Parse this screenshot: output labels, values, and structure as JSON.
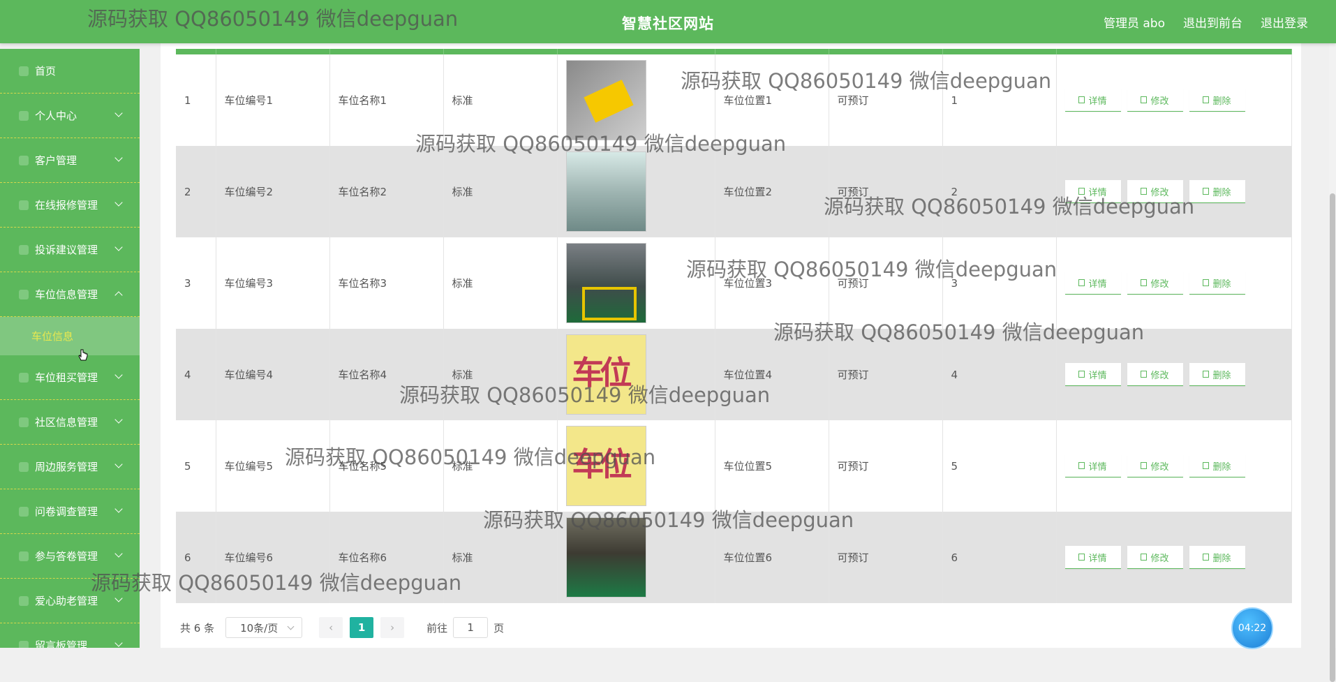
{
  "header": {
    "title": "智慧社区网站",
    "admin_label": "管理员 abo",
    "to_front": "退出到前台",
    "logout": "退出登录"
  },
  "sidebar": {
    "items": [
      {
        "label": "首页",
        "icon": "home-icon",
        "expandable": false
      },
      {
        "label": "个人中心",
        "icon": "user-icon",
        "expandable": true
      },
      {
        "label": "客户管理",
        "icon": "user-icon",
        "expandable": true
      },
      {
        "label": "在线报修管理",
        "icon": "repair-icon",
        "expandable": true
      },
      {
        "label": "投诉建议管理",
        "icon": "complaint-icon",
        "expandable": true
      },
      {
        "label": "车位信息管理",
        "icon": "parking-icon",
        "expandable": true,
        "expanded": true
      }
    ],
    "active_sub": "车位信息",
    "items_after": [
      {
        "label": "车位租买管理",
        "icon": "parking-icon"
      },
      {
        "label": "社区信息管理",
        "icon": "community-icon"
      },
      {
        "label": "周边服务管理",
        "icon": "service-icon"
      },
      {
        "label": "问卷调查管理",
        "icon": "survey-icon"
      },
      {
        "label": "参与答卷管理",
        "icon": "survey-icon"
      },
      {
        "label": "爱心助老管理",
        "icon": "heart-icon"
      },
      {
        "label": "留言板管理",
        "icon": "message-icon"
      }
    ]
  },
  "table": {
    "rows": [
      {
        "index": "1",
        "code": "车位编号1",
        "name": "车位名称1",
        "type": "标准",
        "img": "t1",
        "location": "车位位置1",
        "status": "可预订",
        "num": "1"
      },
      {
        "index": "2",
        "code": "车位编号2",
        "name": "车位名称2",
        "type": "标准",
        "img": "t2",
        "location": "车位位置2",
        "status": "可预订",
        "num": "2"
      },
      {
        "index": "3",
        "code": "车位编号3",
        "name": "车位名称3",
        "type": "标准",
        "img": "t3",
        "location": "车位位置3",
        "status": "可预订",
        "num": "3"
      },
      {
        "index": "4",
        "code": "车位编号4",
        "name": "车位名称4",
        "type": "标准",
        "img": "t4",
        "location": "车位位置4",
        "status": "可预订",
        "num": "4"
      },
      {
        "index": "5",
        "code": "车位编号5",
        "name": "车位名称5",
        "type": "标准",
        "img": "t4",
        "location": "车位位置5",
        "status": "可预订",
        "num": "5"
      },
      {
        "index": "6",
        "code": "车位编号6",
        "name": "车位名称6",
        "type": "标准",
        "img": "t6",
        "location": "车位位置6",
        "status": "可预订",
        "num": "6"
      }
    ],
    "actions": {
      "detail": "详情",
      "edit": "修改",
      "delete": "删除"
    }
  },
  "pagination": {
    "total": "共 6 条",
    "page_size": "10条/页",
    "current_page": "1",
    "jump_prefix": "前往",
    "jump_value": "1",
    "jump_suffix": "页"
  },
  "timer": "04:22",
  "watermark": "源码获取 QQ86050149 微信deepguan",
  "colors": {
    "primary": "#5cb85c",
    "active_page": "#20b2a0",
    "submenu_text": "#e8e84f"
  }
}
